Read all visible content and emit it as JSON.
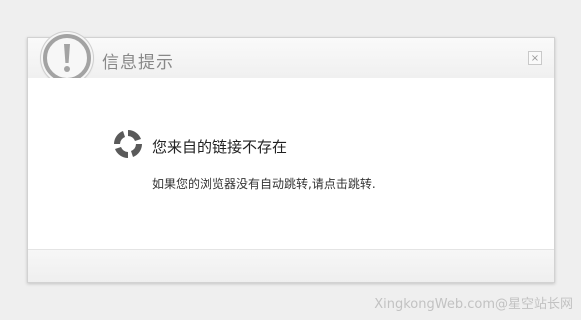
{
  "dialog": {
    "title": "信息提示",
    "close_label": "×",
    "message_title": "您来自的链接不存在",
    "message_prefix": "如果您的浏览器没有自动跳转,",
    "message_link": "请点击跳转.",
    "icons": {
      "badge": "exclamation-icon",
      "loader": "loading-spinner-icon"
    }
  },
  "watermark": "XingkongWeb.com@星空站长网",
  "colors": {
    "background": "#efefef",
    "dialog_bg": "#ffffff",
    "title_text": "#888888",
    "badge_stroke": "#a0a0a0"
  }
}
